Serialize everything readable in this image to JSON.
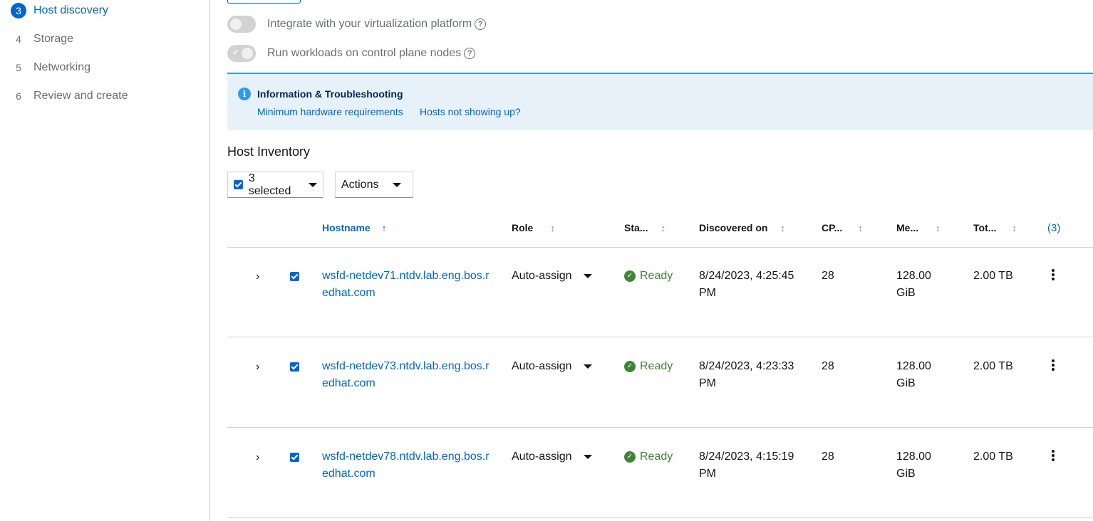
{
  "sidebar": {
    "steps": [
      {
        "num": "3",
        "label": "Host discovery",
        "current": true
      },
      {
        "num": "4",
        "label": "Storage"
      },
      {
        "num": "5",
        "label": "Networking"
      },
      {
        "num": "6",
        "label": "Review and create"
      }
    ]
  },
  "toggles": [
    {
      "label": "Integrate with your virtualization platform",
      "on": false
    },
    {
      "label": "Run workloads on control plane nodes",
      "on": true
    }
  ],
  "alert": {
    "title": "Information & Troubleshooting",
    "links": [
      "Minimum hardware requirements",
      "Hosts not showing up?"
    ]
  },
  "inventory": {
    "title": "Host Inventory",
    "bulk_select_label": "3 selected",
    "actions_label": "Actions",
    "columns": [
      "Hostname",
      "Role",
      "Sta...",
      "Discovered on",
      "CP...",
      "Me...",
      "Tot...",
      "(3)"
    ],
    "rows": [
      {
        "hostname": "wsfd-netdev71.ntdv.lab.eng.bos.redhat.com",
        "role": "Auto-assign",
        "status": "Ready",
        "discovered": "8/24/2023, 4:25:45 PM",
        "cpu": "28",
        "memory": "128.00 GiB",
        "total": "2.00 TB"
      },
      {
        "hostname": "wsfd-netdev73.ntdv.lab.eng.bos.redhat.com",
        "role": "Auto-assign",
        "status": "Ready",
        "discovered": "8/24/2023, 4:23:33 PM",
        "cpu": "28",
        "memory": "128.00 GiB",
        "total": "2.00 TB"
      },
      {
        "hostname": "wsfd-netdev78.ntdv.lab.eng.bos.redhat.com",
        "role": "Auto-assign",
        "status": "Ready",
        "discovered": "8/24/2023, 4:15:19 PM",
        "cpu": "28",
        "memory": "128.00 GiB",
        "total": "2.00 TB"
      }
    ]
  }
}
